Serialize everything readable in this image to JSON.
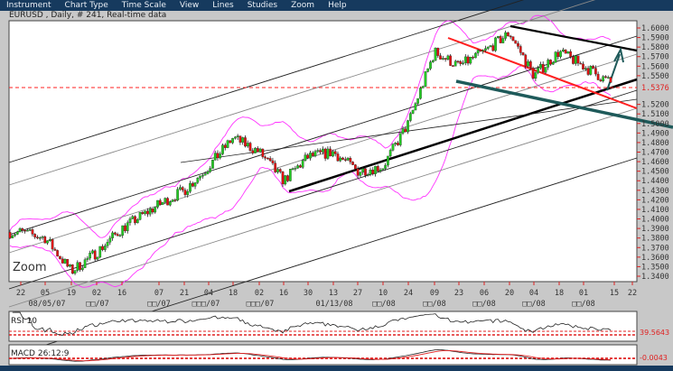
{
  "menu": [
    "Instrument",
    "Chart Type",
    "Time Scale",
    "View",
    "Lines",
    "Studies",
    "Zoom",
    "Help"
  ],
  "title": "EURUSD , Daily, # 241, Real-time data",
  "zoom_label": "Zoom",
  "colors": {
    "menubar": "#163a5e",
    "up": "#22cc22",
    "down": "#e01010",
    "bollinger": "#ff33ff",
    "trend_red": "#ff2020",
    "trend_teal": "#1e5a5a",
    "level": "#ff2020"
  },
  "chart_data": {
    "type": "candlestick",
    "title": "EURUSD , Daily, # 241, Real-time data",
    "ylim": [
      1.335,
      1.605
    ],
    "y_ticks": [
      "1.6000",
      "1.5900",
      "1.5800",
      "1.5700",
      "1.5600",
      "1.5500",
      "1.5200",
      "1.5100",
      "1.5000",
      "1.4900",
      "1.4800",
      "1.4700",
      "1.4600",
      "1.4500",
      "1.4400",
      "1.4300",
      "1.4200",
      "1.4100",
      "1.4000",
      "1.3900",
      "1.3800",
      "1.3700",
      "1.3600",
      "1.3500",
      "1.3400"
    ],
    "current_level": {
      "label": "1.5376",
      "value": 1.5376
    },
    "x_ticks": [
      "22",
      "05",
      "19",
      "02",
      "16",
      "07",
      "21",
      "04",
      "18",
      "02",
      "16",
      "30",
      "13",
      "27",
      "10",
      "24",
      "09",
      "23",
      "06",
      "20",
      "04",
      "18",
      "01",
      "15",
      "22"
    ],
    "x_month_labels": [
      "08/05/07",
      "□□/07",
      "□□/07",
      "□□□/07",
      "□□□/07",
      "01/13/08",
      "□□/08",
      "□□/08",
      "□□/08",
      "□□/08",
      "□□/08"
    ],
    "close_at_ticks": [
      1.386,
      1.38,
      1.345,
      1.365,
      1.39,
      1.415,
      1.43,
      1.455,
      1.485,
      1.47,
      1.44,
      1.465,
      1.47,
      1.45,
      1.455,
      1.5,
      1.575,
      1.56,
      1.575,
      1.595,
      1.55,
      1.575,
      1.56,
      1.54,
      null
    ],
    "overlays": [
      "Bollinger bands",
      "regression channel",
      "trend lines",
      "arrow"
    ]
  },
  "rsi": {
    "label": "RSI 10",
    "value": "39.5643"
  },
  "macd": {
    "label": "MACD 26:12:9",
    "value": "-0.0043"
  }
}
